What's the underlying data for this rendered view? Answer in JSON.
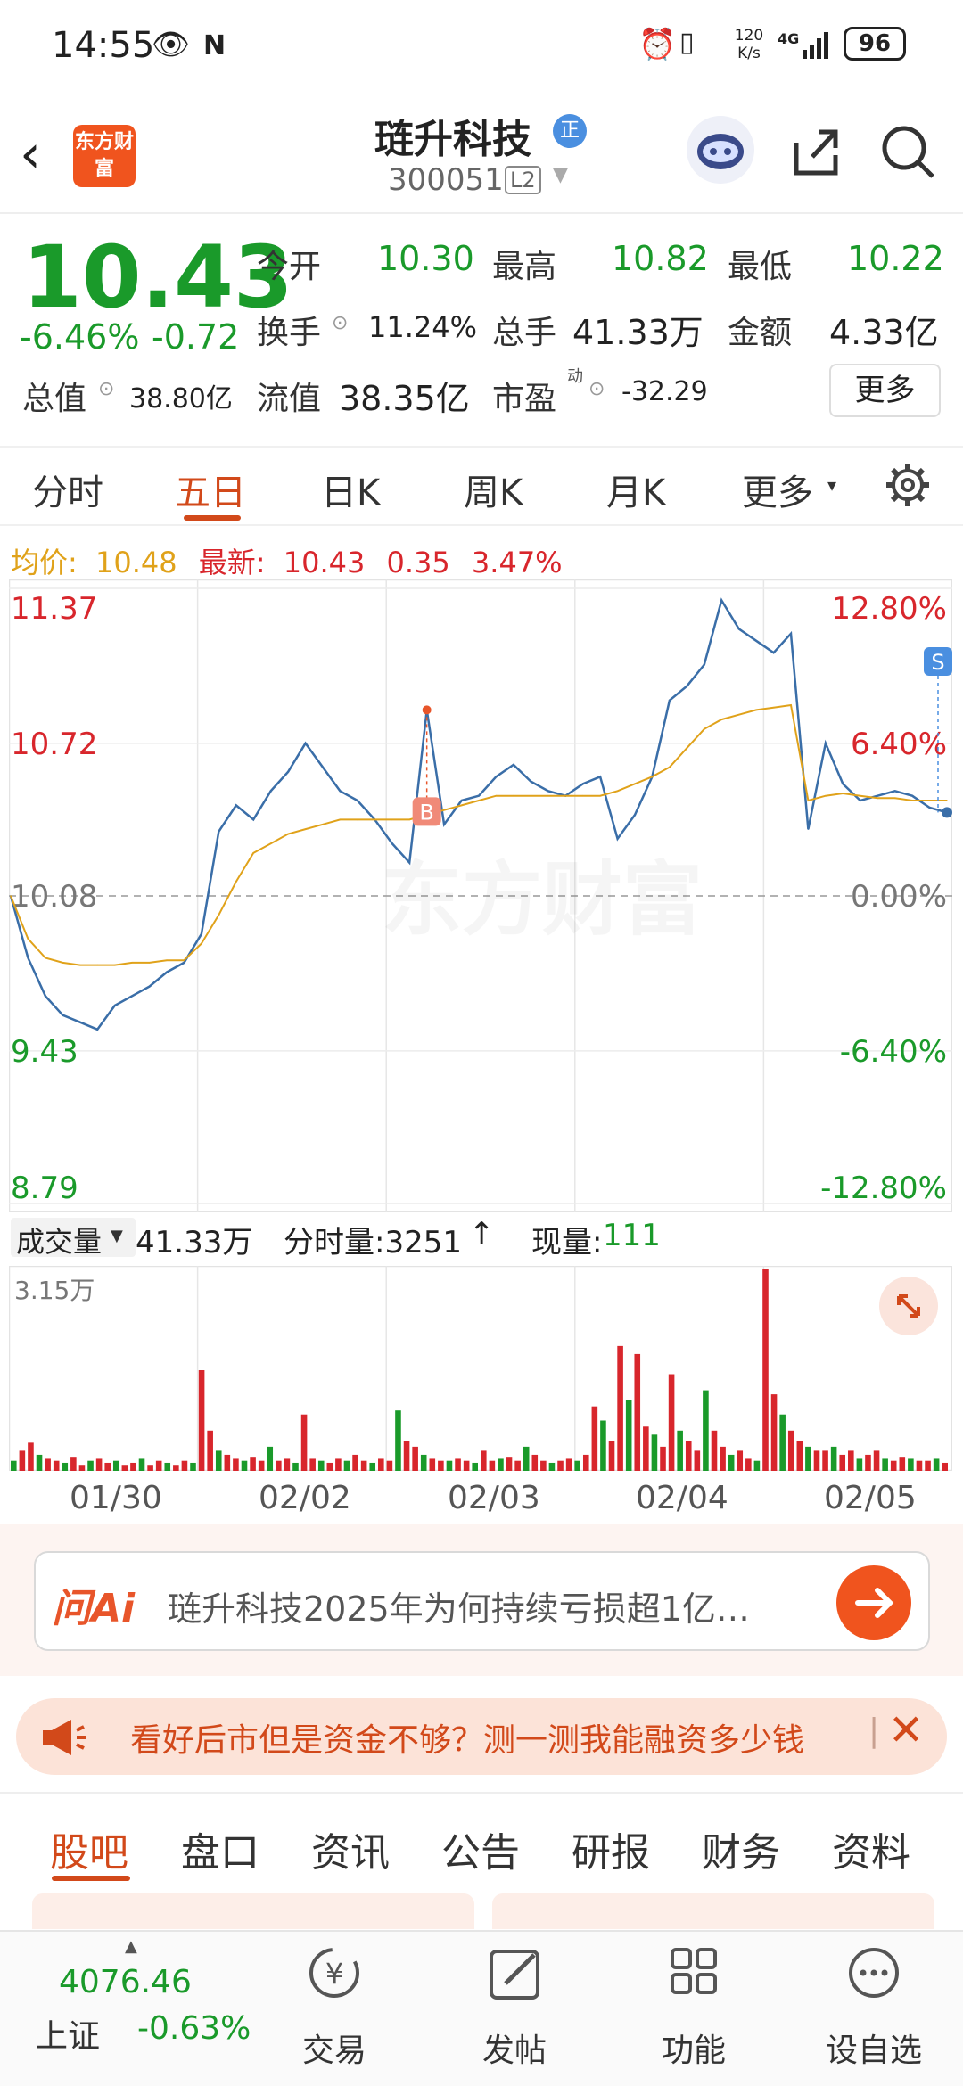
{
  "status_bar": {
    "time": "14:55",
    "network_speed": "120 K/s",
    "network": "4G",
    "battery": "96"
  },
  "header": {
    "logo_text": "东方财富",
    "stock_name": "琏升科技",
    "badge": "正",
    "stock_code": "300051",
    "level": "L2"
  },
  "quote": {
    "price": "10.43",
    "change_pct": "-6.46%",
    "change": "-0.72",
    "open_label": "今开",
    "open": "10.30",
    "high_label": "最高",
    "high": "10.82",
    "low_label": "最低",
    "low": "10.22",
    "turnover_label": "换手",
    "turnover": "11.24%",
    "volume_label": "总手",
    "volume": "41.33万",
    "amount_label": "金额",
    "amount": "4.33亿",
    "total_cap_label": "总值",
    "total_cap": "38.80亿",
    "float_cap_label": "流值",
    "float_cap": "38.35亿",
    "pe_label": "市盈",
    "pe_sup": "动",
    "pe": "-32.29",
    "more_button": "更多"
  },
  "period_tabs": [
    "分时",
    "五日",
    "日K",
    "周K",
    "月K",
    "更多"
  ],
  "active_period": "五日",
  "chart_header": {
    "avg_label": "均价:",
    "avg": "10.48",
    "latest_label": "最新:",
    "latest": "10.43",
    "diff": "0.35",
    "pct": "3.47%"
  },
  "chart_data": {
    "type": "line",
    "y_left_ticks": [
      "11.37",
      "10.72",
      "10.08",
      "9.43",
      "8.79"
    ],
    "y_right_ticks": [
      "12.80%",
      "6.40%",
      "0.00%",
      "-6.40%",
      "-12.80%"
    ],
    "ylim": [
      8.79,
      11.37
    ],
    "x": [
      "01/30",
      "02/02",
      "02/03",
      "02/04",
      "02/05"
    ],
    "series": [
      {
        "name": "price",
        "values": [
          10.08,
          9.82,
          9.66,
          9.58,
          9.55,
          9.52,
          9.62,
          9.66,
          9.7,
          9.76,
          9.8,
          9.92,
          10.35,
          10.46,
          10.4,
          10.52,
          10.6,
          10.72,
          10.62,
          10.52,
          10.48,
          10.4,
          10.3,
          10.22,
          10.86,
          10.38,
          10.48,
          10.5,
          10.58,
          10.63,
          10.56,
          10.52,
          10.5,
          10.55,
          10.58,
          10.32,
          10.42,
          10.58,
          10.9,
          10.96,
          11.05,
          11.32,
          11.2,
          11.15,
          11.1,
          11.18,
          10.36,
          10.72,
          10.55,
          10.48,
          10.5,
          10.52,
          10.5,
          10.45,
          10.43
        ]
      },
      {
        "name": "avg",
        "values": [
          10.08,
          9.9,
          9.82,
          9.8,
          9.79,
          9.79,
          9.79,
          9.8,
          9.8,
          9.81,
          9.81,
          9.88,
          10.0,
          10.14,
          10.26,
          10.3,
          10.34,
          10.36,
          10.38,
          10.4,
          10.4,
          10.4,
          10.4,
          10.4,
          10.42,
          10.44,
          10.46,
          10.48,
          10.5,
          10.5,
          10.5,
          10.5,
          10.5,
          10.5,
          10.5,
          10.52,
          10.55,
          10.58,
          10.62,
          10.7,
          10.78,
          10.82,
          10.84,
          10.86,
          10.87,
          10.88,
          10.48,
          10.5,
          10.51,
          10.5,
          10.49,
          10.49,
          10.48,
          10.48,
          10.48
        ]
      }
    ],
    "markers": [
      "B",
      "S"
    ]
  },
  "volume": {
    "label": "成交量",
    "total": "41.33万",
    "tick_label": "分时量:3251",
    "now_label": "现量:",
    "now": "111",
    "max_label": "3.15万"
  },
  "volume_bars": [
    0.05,
    0.1,
    0.14,
    0.08,
    0.06,
    0.05,
    0.04,
    0.07,
    0.03,
    0.05,
    0.06,
    0.04,
    0.05,
    0.03,
    0.04,
    0.06,
    0.03,
    0.05,
    0.04,
    0.03,
    0.05,
    0.04,
    0.5,
    0.2,
    0.1,
    0.08,
    0.06,
    0.05,
    0.07,
    0.05,
    0.12,
    0.05,
    0.06,
    0.04,
    0.28,
    0.06,
    0.05,
    0.04,
    0.06,
    0.05,
    0.08,
    0.05,
    0.04,
    0.06,
    0.05,
    0.3,
    0.15,
    0.12,
    0.08,
    0.06,
    0.05,
    0.05,
    0.06,
    0.05,
    0.04,
    0.1,
    0.05,
    0.06,
    0.07,
    0.05,
    0.12,
    0.08,
    0.05,
    0.04,
    0.05,
    0.06,
    0.05,
    0.08,
    0.32,
    0.25,
    0.15,
    0.62,
    0.35,
    0.58,
    0.22,
    0.18,
    0.12,
    0.48,
    0.2,
    0.15,
    0.1,
    0.4,
    0.2,
    0.12,
    0.08,
    0.1,
    0.06,
    0.05,
    1.0,
    0.38,
    0.28,
    0.2,
    0.15,
    0.12,
    0.1,
    0.1,
    0.12,
    0.08,
    0.1,
    0.06,
    0.08,
    0.1,
    0.06,
    0.05,
    0.07,
    0.06,
    0.05,
    0.05,
    0.06,
    0.04
  ],
  "ai_box": {
    "logo": "问Ai",
    "prompt": "琏升科技2025年为何持续亏损超1亿…"
  },
  "promo": {
    "text": "看好后市但是资金不够？测一测我能融资多少钱"
  },
  "bottom_tabs": [
    "股吧",
    "盘口",
    "资讯",
    "公告",
    "研报",
    "财务",
    "资料"
  ],
  "active_bottom_tab": "股吧",
  "index_ticker": {
    "name": "上证",
    "value": "4076.46",
    "change": "-0.63%"
  },
  "nav": [
    {
      "label": "交易",
      "icon": "trade-icon"
    },
    {
      "label": "发帖",
      "icon": "edit-icon"
    },
    {
      "label": "功能",
      "icon": "grid-icon"
    },
    {
      "label": "设自选",
      "icon": "more-icon"
    }
  ],
  "colors": {
    "up": "#d8262c",
    "down": "#1a9a2a",
    "accent": "#d2491a",
    "price_line": "#3a6ea8",
    "avg_line": "#e0a21a"
  }
}
